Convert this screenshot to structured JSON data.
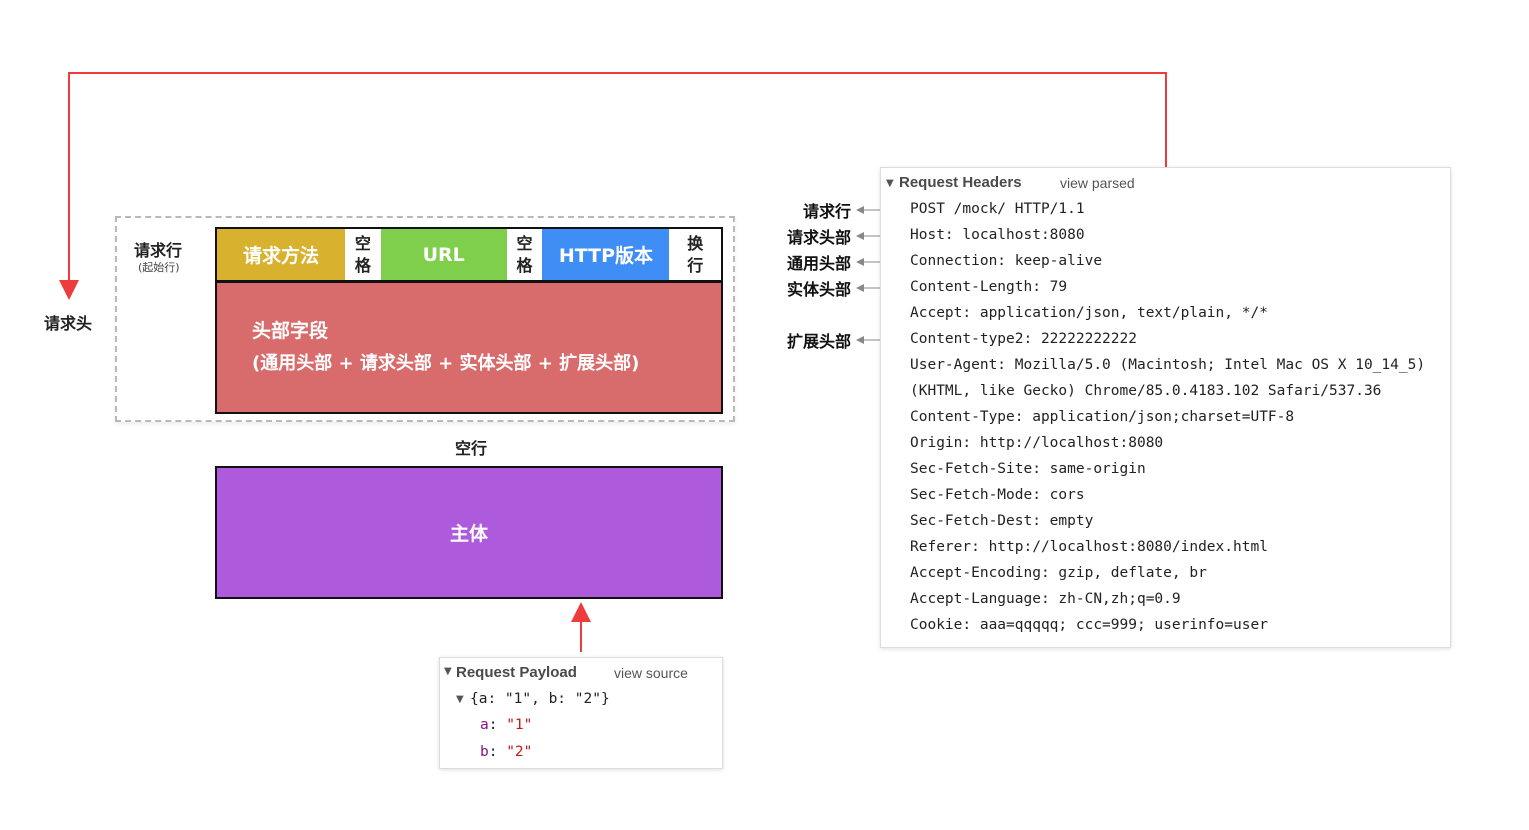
{
  "labels": {
    "request_head": "请求头",
    "request_line": "请求行",
    "request_line_sub": "(起始行)",
    "blank_line": "空行"
  },
  "request_line": {
    "method": "请求方法",
    "space1": [
      "空",
      "格"
    ],
    "url": "URL",
    "space2": [
      "空",
      "格"
    ],
    "http_version": "HTTP版本",
    "crlf": [
      "换",
      "行"
    ]
  },
  "header_fields": {
    "title": "头部字段",
    "description": "(通用头部 + 请求头部 + 实体头部 + 扩展头部)"
  },
  "body": {
    "label": "主体"
  },
  "colors": {
    "method": "#d8b22f",
    "url": "#80cf4c",
    "http_version": "#3f8ef5",
    "headers": "#d86b6b",
    "body": "#ad5bdc",
    "connector": "#ee3b3b"
  },
  "payload_panel": {
    "title": "Request Payload",
    "link": "view source",
    "summary": "{a: \"1\", b: \"2\"}",
    "entries": [
      {
        "key": "a",
        "value": "\"1\""
      },
      {
        "key": "b",
        "value": "\"2\""
      }
    ]
  },
  "headers_panel": {
    "title": "Request Headers",
    "link": "view parsed",
    "lines": [
      "POST /mock/ HTTP/1.1",
      "Host: localhost:8080",
      "Connection: keep-alive",
      "Content-Length: 79",
      "Accept: application/json, text/plain, */*",
      "Content-type2: 22222222222",
      "User-Agent: Mozilla/5.0 (Macintosh; Intel Mac OS X 10_14_5)",
      "(KHTML, like Gecko) Chrome/85.0.4183.102 Safari/537.36",
      "Content-Type: application/json;charset=UTF-8",
      "Origin: http://localhost:8080",
      "Sec-Fetch-Site: same-origin",
      "Sec-Fetch-Mode: cors",
      "Sec-Fetch-Dest: empty",
      "Referer: http://localhost:8080/index.html",
      "Accept-Encoding: gzip, deflate, br",
      "Accept-Language: zh-CN,zh;q=0.9",
      "Cookie: aaa=qqqqq; ccc=999; userinfo=user"
    ]
  },
  "annotations": [
    {
      "label": "请求行",
      "line": 0
    },
    {
      "label": "请求头部",
      "line": 1
    },
    {
      "label": "通用头部",
      "line": 2
    },
    {
      "label": "实体头部",
      "line": 3
    },
    {
      "label": "扩展头部",
      "line": 5
    }
  ]
}
